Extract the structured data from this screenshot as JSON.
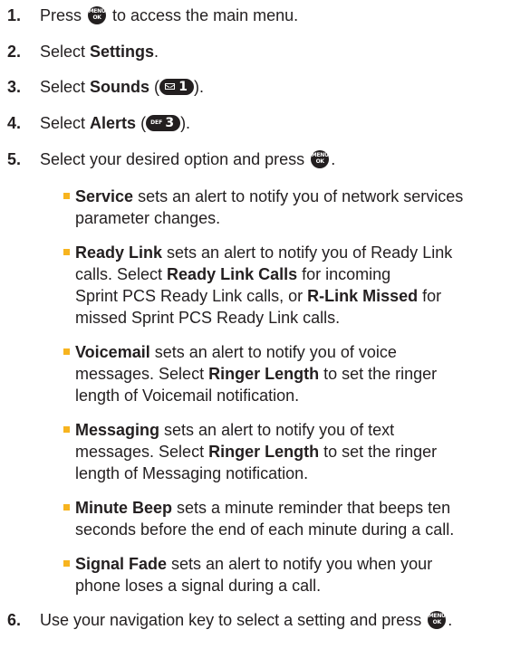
{
  "steps": [
    {
      "num": "1.",
      "pre": "Press ",
      "post": " to access the main menu."
    },
    {
      "num": "2.",
      "pre": "Select ",
      "bold": "Settings",
      "post": "."
    },
    {
      "num": "3.",
      "pre": "Select ",
      "bold": "Sounds",
      "post": " (",
      "end": ")."
    },
    {
      "num": "4.",
      "pre": "Select ",
      "bold": "Alerts",
      "post": " (",
      "end": ")."
    },
    {
      "num": "5.",
      "pre": "Select your desired option and press ",
      "end": "."
    },
    {
      "num": "6.",
      "pre": "Use your navigation key to select a setting and press ",
      "end": "."
    }
  ],
  "keys": {
    "menu_ok": {
      "top": "MENU",
      "bottom": "OK"
    },
    "key1": {
      "number": "1"
    },
    "key3": {
      "letters": "DEF",
      "number": "3"
    }
  },
  "bullets": [
    {
      "lines": [
        [
          {
            "b": "Service"
          },
          {
            "t": " sets an alert to notify you of network services"
          }
        ],
        [
          {
            "t": "parameter changes."
          }
        ]
      ]
    },
    {
      "lines": [
        [
          {
            "b": "Ready Link"
          },
          {
            "t": " sets an alert to notify you of Ready Link"
          }
        ],
        [
          {
            "t": "calls. Select "
          },
          {
            "b": "Ready Link Calls"
          },
          {
            "t": " for incoming"
          }
        ],
        [
          {
            "t": "Sprint PCS Ready Link calls, or "
          },
          {
            "b": "R-Link Missed"
          },
          {
            "t": " for"
          }
        ],
        [
          {
            "t": "missed Sprint PCS Ready Link calls."
          }
        ]
      ]
    },
    {
      "lines": [
        [
          {
            "b": "Voicemail"
          },
          {
            "t": " sets an alert to notify you of voice"
          }
        ],
        [
          {
            "t": "messages. Select "
          },
          {
            "b": "Ringer Length"
          },
          {
            "t": " to set the ringer"
          }
        ],
        [
          {
            "t": "length of Voicemail notification."
          }
        ]
      ]
    },
    {
      "lines": [
        [
          {
            "b": "Messaging"
          },
          {
            "t": " sets an alert to notify you of text"
          }
        ],
        [
          {
            "t": "messages. Select "
          },
          {
            "b": "Ringer Length"
          },
          {
            "t": " to set the ringer"
          }
        ],
        [
          {
            "t": "length of Messaging notification."
          }
        ]
      ]
    },
    {
      "lines": [
        [
          {
            "b": "Minute Beep"
          },
          {
            "t": " sets a minute reminder that beeps ten"
          }
        ],
        [
          {
            "t": "seconds before the end of each minute during a call."
          }
        ]
      ]
    },
    {
      "lines": [
        [
          {
            "b": "Signal Fade"
          },
          {
            "t": " sets an alert to notify you when your"
          }
        ],
        [
          {
            "t": "phone loses a signal during a call."
          }
        ]
      ]
    }
  ],
  "colors": {
    "bullet": "#f7b41f",
    "text": "#231f20",
    "key": "#231f20"
  }
}
